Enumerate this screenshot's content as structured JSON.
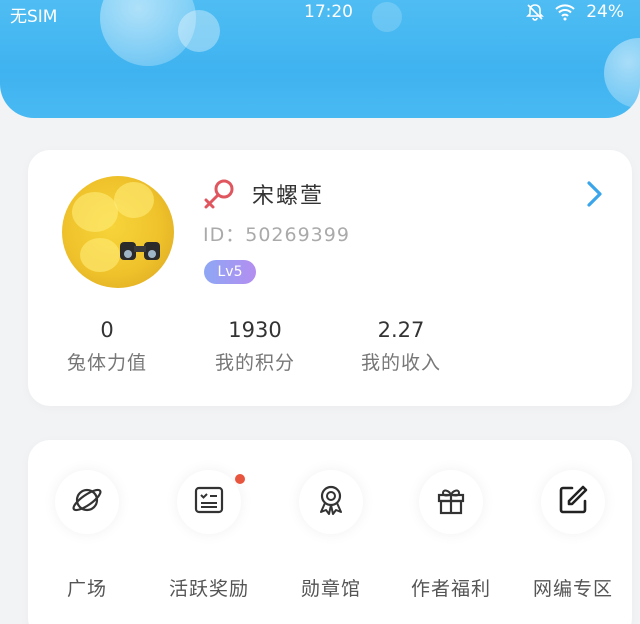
{
  "status_bar": {
    "carrier": "无SIM",
    "time": "17:20",
    "battery": "24%"
  },
  "profile": {
    "username": "宋螺萱",
    "id_text": "ID：50269399",
    "level": "Lv5",
    "stats": [
      {
        "value": "0",
        "label": "兔体力值"
      },
      {
        "value": "1930",
        "label": "我的积分"
      },
      {
        "value": "2.27",
        "label": "我的收入"
      }
    ]
  },
  "functions": [
    {
      "label": "广场",
      "icon": "planet-icon",
      "has_dot": false
    },
    {
      "label": "活跃奖励",
      "icon": "checklist-icon",
      "has_dot": true
    },
    {
      "label": "勋章馆",
      "icon": "medal-icon",
      "has_dot": false
    },
    {
      "label": "作者福利",
      "icon": "gift-icon",
      "has_dot": false
    },
    {
      "label": "网编专区",
      "icon": "edit-icon",
      "has_dot": false
    }
  ],
  "colors": {
    "header_blue": "#44b8f2",
    "chevron_blue": "#3aa5ea",
    "badge_gradient_start": "#8ea7f5",
    "badge_gradient_end": "#b38ef0",
    "notification_dot": "#e8553e",
    "gender_icon": "#e0565f"
  }
}
